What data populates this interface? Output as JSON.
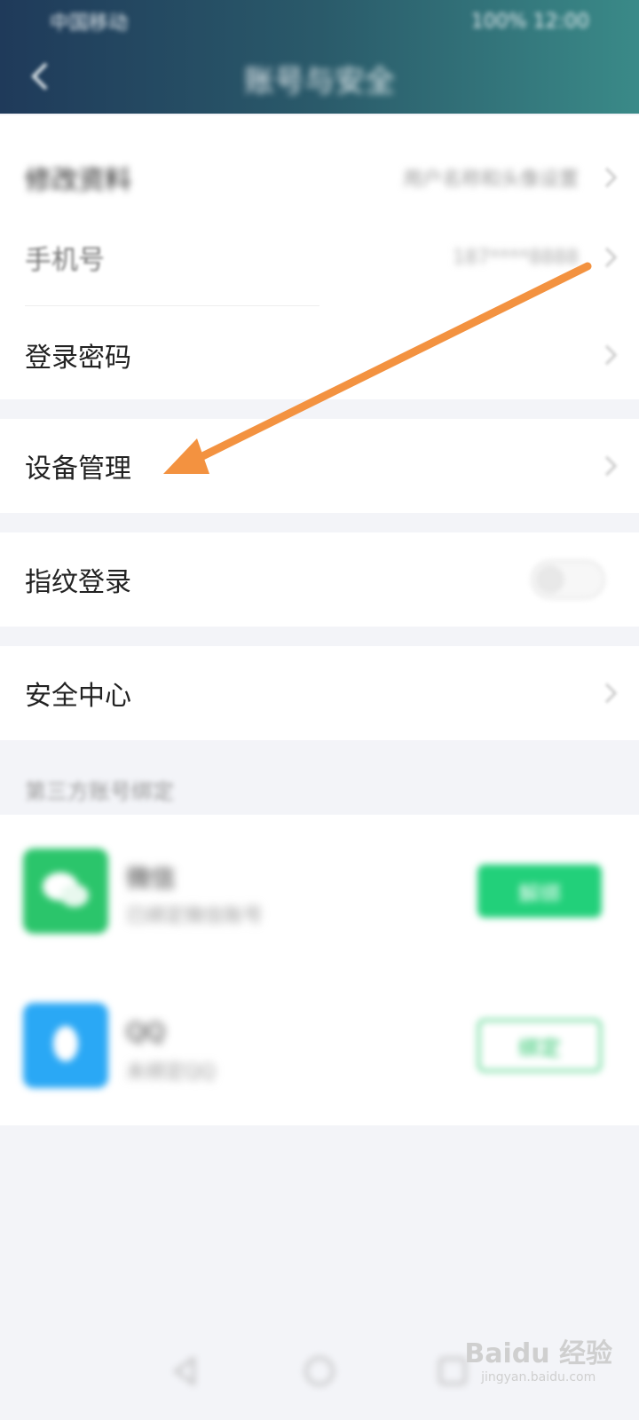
{
  "status_bar": {
    "left": "中国移动",
    "right": "100% 12:00"
  },
  "header": {
    "title": "账号与安全",
    "background": "#2a5a6a"
  },
  "rows": {
    "account_avatar": {
      "label": "修改资料",
      "value": "用户名称和头像设置"
    },
    "phone": {
      "label": "手机号",
      "value": "187****8888"
    },
    "login_password": {
      "label": "登录密码"
    },
    "device_management": {
      "label": "设备管理"
    },
    "fingerprint_login": {
      "label": "指纹登录"
    },
    "security_center": {
      "label": "安全中心"
    }
  },
  "third_party": {
    "section_title": "第三方账号绑定",
    "items": [
      {
        "name": "微信",
        "subtitle": "已绑定微信账号",
        "button": "解绑",
        "icon": "wechat-icon",
        "color": "#2bc56b"
      },
      {
        "name": "QQ",
        "subtitle": "未绑定QQ",
        "button": "绑定",
        "icon": "qq-icon",
        "color": "#2aa8f5"
      }
    ]
  },
  "annotation": {
    "color": "#f39240"
  },
  "watermark": {
    "logo": "Baidu 经验",
    "url": "jingyan.baidu.com"
  }
}
